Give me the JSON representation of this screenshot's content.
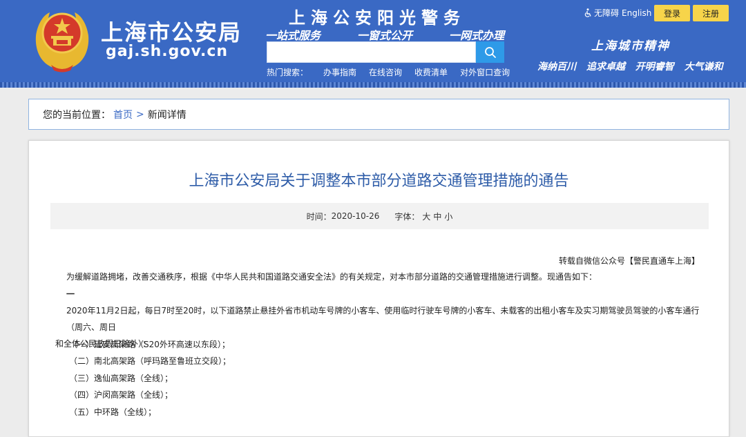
{
  "header": {
    "logo_cn": "上海市公安局",
    "logo_en": "gaj.sh.gov.cn",
    "slogan_main": "上海公安阳光警务",
    "slogan_sub": [
      "一站式服务",
      "一窗式公开",
      "一网式办理"
    ],
    "search": {
      "placeholder": "",
      "value": ""
    },
    "hot_label": "热门搜索：",
    "hot_links": [
      "办事指南",
      "在线咨询",
      "收费清单",
      "对外窗口查询"
    ],
    "accessibility": "无障碍",
    "english": "English",
    "login": "登录",
    "register": "注册",
    "city_title": "上海城市精神",
    "city_motto": [
      "海纳百川",
      "追求卓越",
      "开明睿智",
      "大气谦和"
    ],
    "colors": {
      "bg": "#3a69c4",
      "button": "#f7d44a",
      "search_btn": "#2e9ae8"
    }
  },
  "breadcrumb": {
    "label": "您的当前位置：",
    "home": "首页",
    "separator": ">",
    "current": "新闻详情"
  },
  "article": {
    "title": "上海市公安局关于调整本市部分道路交通管理措施的通告",
    "time_label": "时间：",
    "time_value": "2020-10-26",
    "font_label": "字体：",
    "font_sizes": [
      "大",
      "中",
      "小"
    ],
    "source": "转载自微信公众号【警民直通车上海】",
    "intro": "为缓解道路拥堵，改善交通秩序，根据《中华人民共和国道路交通安全法》的有关规定，对本市部分道路的交通管理措施进行调整。现通告如下：",
    "section": "一",
    "main_line1": "2020年11月2日起，每日7时至20时，以下道路禁止悬挂外省市机动车号牌的小客车、使用临时行驶车号牌的小客车、未载客的出租小客车及实习期驾驶员驾驶的小客车通行（周六、周日",
    "main_line2": "和全体公民放假日除外）：",
    "roads": [
      "（一）延安高架路（S20外环高速以东段）；",
      "（二）南北高架路（呼玛路至鲁班立交段）；",
      "（三）逸仙高架路（全线）；",
      "（四）沪闵高架路（全线）；",
      "（五）中环路（全线）；"
    ]
  }
}
